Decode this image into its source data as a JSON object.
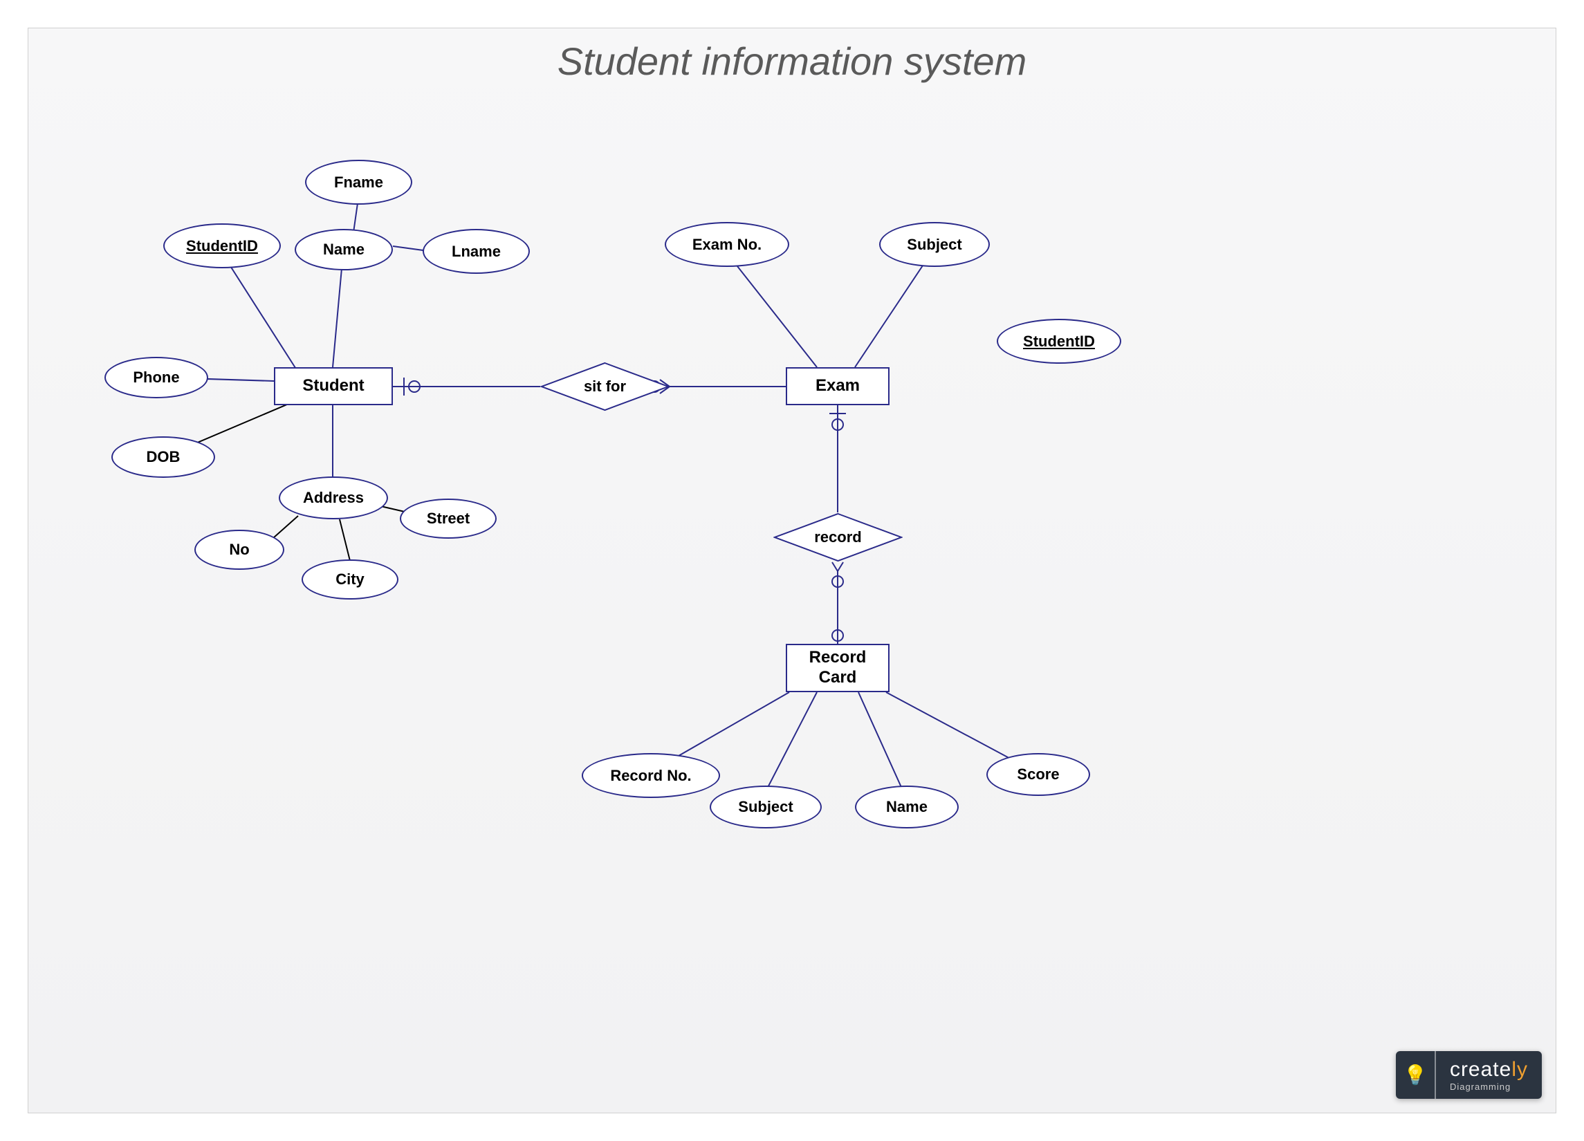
{
  "title": "Student information system",
  "entities": {
    "student": "Student",
    "exam": "Exam",
    "recordcard": "Record Card"
  },
  "relationships": {
    "sitfor": "sit for",
    "record": "record"
  },
  "attributes": {
    "studentid": "StudentID",
    "phone": "Phone",
    "dob": "DOB",
    "name": "Name",
    "fname": "Fname",
    "lname": "Lname",
    "address": "Address",
    "no": "No",
    "city": "City",
    "street": "Street",
    "examno": "Exam No.",
    "subject_exam": "Subject",
    "studentid_exam": "StudentID",
    "recordno": "Record No.",
    "subject_rc": "Subject",
    "name_rc": "Name",
    "score": "Score"
  },
  "logo": {
    "brand_a": "create",
    "brand_b": "ly",
    "sub": "Diagramming"
  }
}
